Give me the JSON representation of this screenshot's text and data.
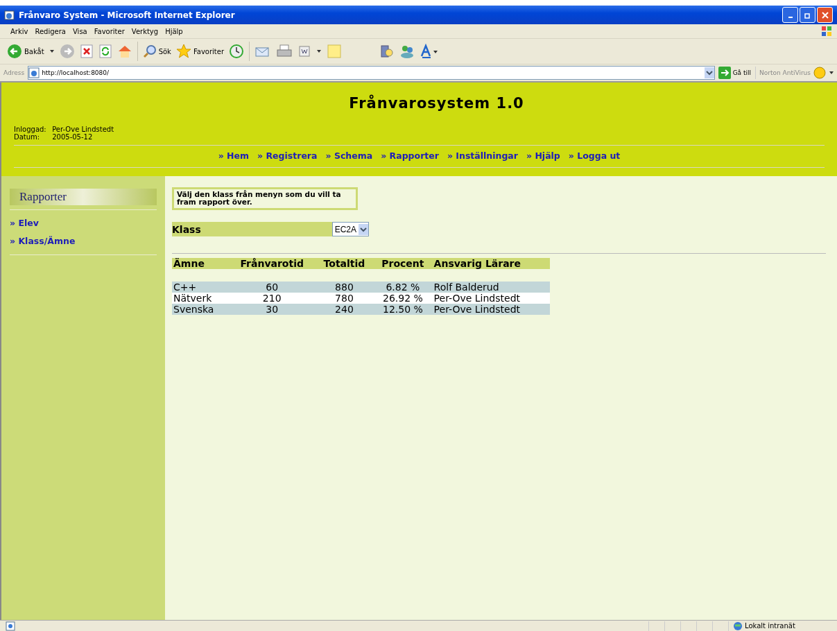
{
  "window": {
    "title": "Frånvaro System - Microsoft Internet Explorer"
  },
  "menu": [
    "Arkiv",
    "Redigera",
    "Visa",
    "Favoriter",
    "Verktyg",
    "Hjälp"
  ],
  "toolbar": {
    "back": "Bakåt",
    "search": "Sök",
    "favorites": "Favoriter"
  },
  "address": {
    "label": "Adress",
    "value": "http://localhost:8080/",
    "go": "Gå till",
    "antivirus": "Norton AntiVirus"
  },
  "header": {
    "title": "Frånvarosystem 1.0",
    "user_label": "Inloggad:",
    "user": "Per-Ove Lindstedt",
    "date_label": "Datum:",
    "date": "2005-05-12"
  },
  "nav": [
    "» Hem",
    "» Registrera",
    "» Schema",
    "» Rapporter",
    "» Inställningar",
    "» Hjälp",
    "» Logga ut"
  ],
  "sidebar": {
    "title": "Rapporter",
    "items": [
      "» Elev",
      "» Klass/Ämne"
    ]
  },
  "instruction": "Välj den klass från menyn som du vill ta fram rapport över.",
  "class_select": {
    "label": "Klass",
    "value": "EC2A"
  },
  "table": {
    "columns": [
      "Ämne",
      "Frånvarotid",
      "Totaltid",
      "Procent",
      "Ansvarig Lärare"
    ],
    "rows": [
      {
        "cells": [
          "C++",
          "60",
          "880",
          "6.82 %",
          "Rolf Balderud"
        ],
        "shaded": true
      },
      {
        "cells": [
          "Nätverk",
          "210",
          "780",
          "26.92 %",
          "Per-Ove Lindstedt"
        ],
        "shaded": false
      },
      {
        "cells": [
          "Svenska",
          "30",
          "240",
          "12.50 %",
          "Per-Ove Lindstedt"
        ],
        "shaded": true
      }
    ]
  },
  "status_bar": {
    "zone": "Lokalt intranät"
  }
}
